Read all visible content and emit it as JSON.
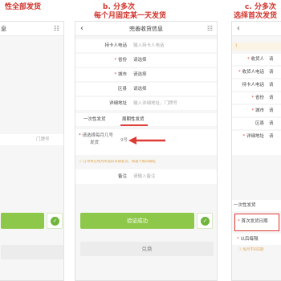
{
  "captions": {
    "left": "性全部发货",
    "middle_line1": "b. 分多次",
    "middle_line2": "每个月固定某一天发货",
    "right_line1": "c. 分多次",
    "right_line2": "选择首次发货"
  },
  "left_phone": {
    "nav_title": "息",
    "address_placeholder": "门牌号"
  },
  "middle_phone": {
    "nav_title": "完善收货信息",
    "form": [
      {
        "label": "持卡人电话",
        "value": "输入持卡人电话",
        "required": false
      },
      {
        "label": "省份",
        "value": "请选择",
        "required": true
      },
      {
        "label": "城市",
        "value": "请选择",
        "required": true
      },
      {
        "label": "区县",
        "value": "请选择",
        "required": false
      },
      {
        "label": "详细地址",
        "value": "输入详细地址，门牌号",
        "required": false
      }
    ],
    "tabs": [
      "一次性发货",
      "周期性发货"
    ],
    "day_label_line1": "请选择每月几号",
    "day_label_line2": "发货",
    "day_value": "9号",
    "tip": "订单将在每月所选的日期发货，如遇节假日顺延",
    "remark_label": "备注",
    "remark_placeholder": "请输入备注",
    "submit_label": "验证成功",
    "exchange_label": "兑换"
  },
  "right_phone": {
    "labels": [
      "收货人",
      "收货人电话",
      "持卡人电话",
      "省份",
      "城市",
      "区县",
      "详细地址"
    ],
    "values": [
      "请",
      "请",
      "请",
      "请",
      "请",
      "请",
      "请"
    ],
    "tab_label": "一次性发货",
    "first_date_label": "首次发货日期",
    "cycle_label": "以后每隔",
    "tip": "每月不同日期"
  },
  "colors": {
    "caption_red": "#d0342c",
    "button_green": "#8ec84a",
    "arrow_red": "#e03a35",
    "tab_red": "#e0403a"
  }
}
